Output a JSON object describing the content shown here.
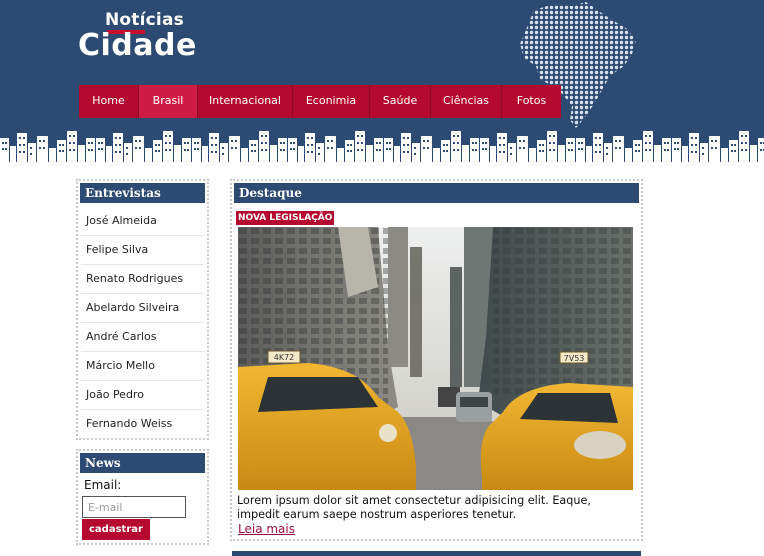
{
  "logo": {
    "small": "Notícias",
    "big": "Cidade"
  },
  "nav": {
    "items": [
      {
        "label": "Home",
        "active": false
      },
      {
        "label": "Brasil",
        "active": true
      },
      {
        "label": "Internacional",
        "active": false
      },
      {
        "label": "Econimia",
        "active": false
      },
      {
        "label": "Saúde",
        "active": false
      },
      {
        "label": "Ciências",
        "active": false
      },
      {
        "label": "Fotos",
        "active": false
      }
    ]
  },
  "sidebar": {
    "interviews_title": "Entrevistas",
    "interviews": [
      "José Almeida",
      "Felipe Silva",
      "Renato Rodrigues",
      "Abelardo Silveira",
      "André Carlos",
      "Márcio Mello",
      "João Pedro",
      "Fernando Weiss"
    ],
    "news": {
      "title": "News",
      "email_label": "Email:",
      "email_placeholder": "E-mail",
      "submit": "cadastrar"
    }
  },
  "featured": {
    "title": "Destaque",
    "tag": "NOVA LEGISLAÇÃO",
    "photo_plates": [
      "4K72",
      "7V53"
    ],
    "body": "Lorem ipsum dolor sit amet consectetur adipisicing elit. Eaque, impedit earum saepe nostrum asperiores tenetur.",
    "read_more": "Leia mais"
  },
  "colors": {
    "navy": "#2d4a72",
    "crimson": "#b5092f",
    "taxi": "#e7a51d"
  }
}
